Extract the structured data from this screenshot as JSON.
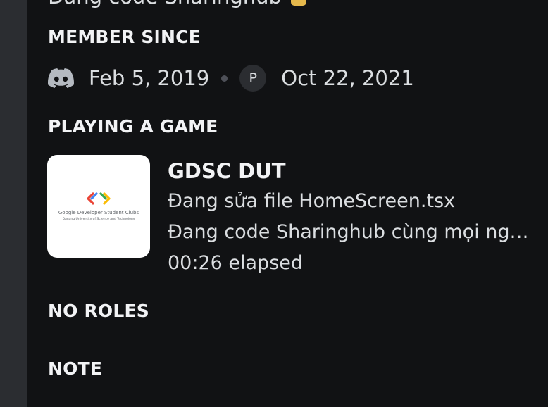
{
  "top_cut_text": "Đang code Sharinghub",
  "member_since": {
    "heading": "MEMBER SINCE",
    "discord_icon": "discord-icon",
    "discord_date": "Feb 5, 2019",
    "server_initial": "P",
    "server_date": "Oct 22, 2021"
  },
  "playing": {
    "heading": "PLAYING A GAME",
    "game_image_text": {
      "name": "Google Developer Student Clubs",
      "university": "Danang University of Science and Technology"
    },
    "game_title": "GDSC DUT",
    "details": "Đang sửa file HomeScreen.tsx",
    "state": "Đang code Sharinghub cùng mọi người",
    "elapsed": "00:26 elapsed"
  },
  "roles": {
    "heading": "NO ROLES"
  },
  "note": {
    "heading": "NOTE"
  },
  "colors": {
    "panel_bg": "#111214",
    "sidebar_bg": "#2b2d31",
    "text_primary": "#f2f3f5",
    "text_secondary": "#dbdee1"
  }
}
